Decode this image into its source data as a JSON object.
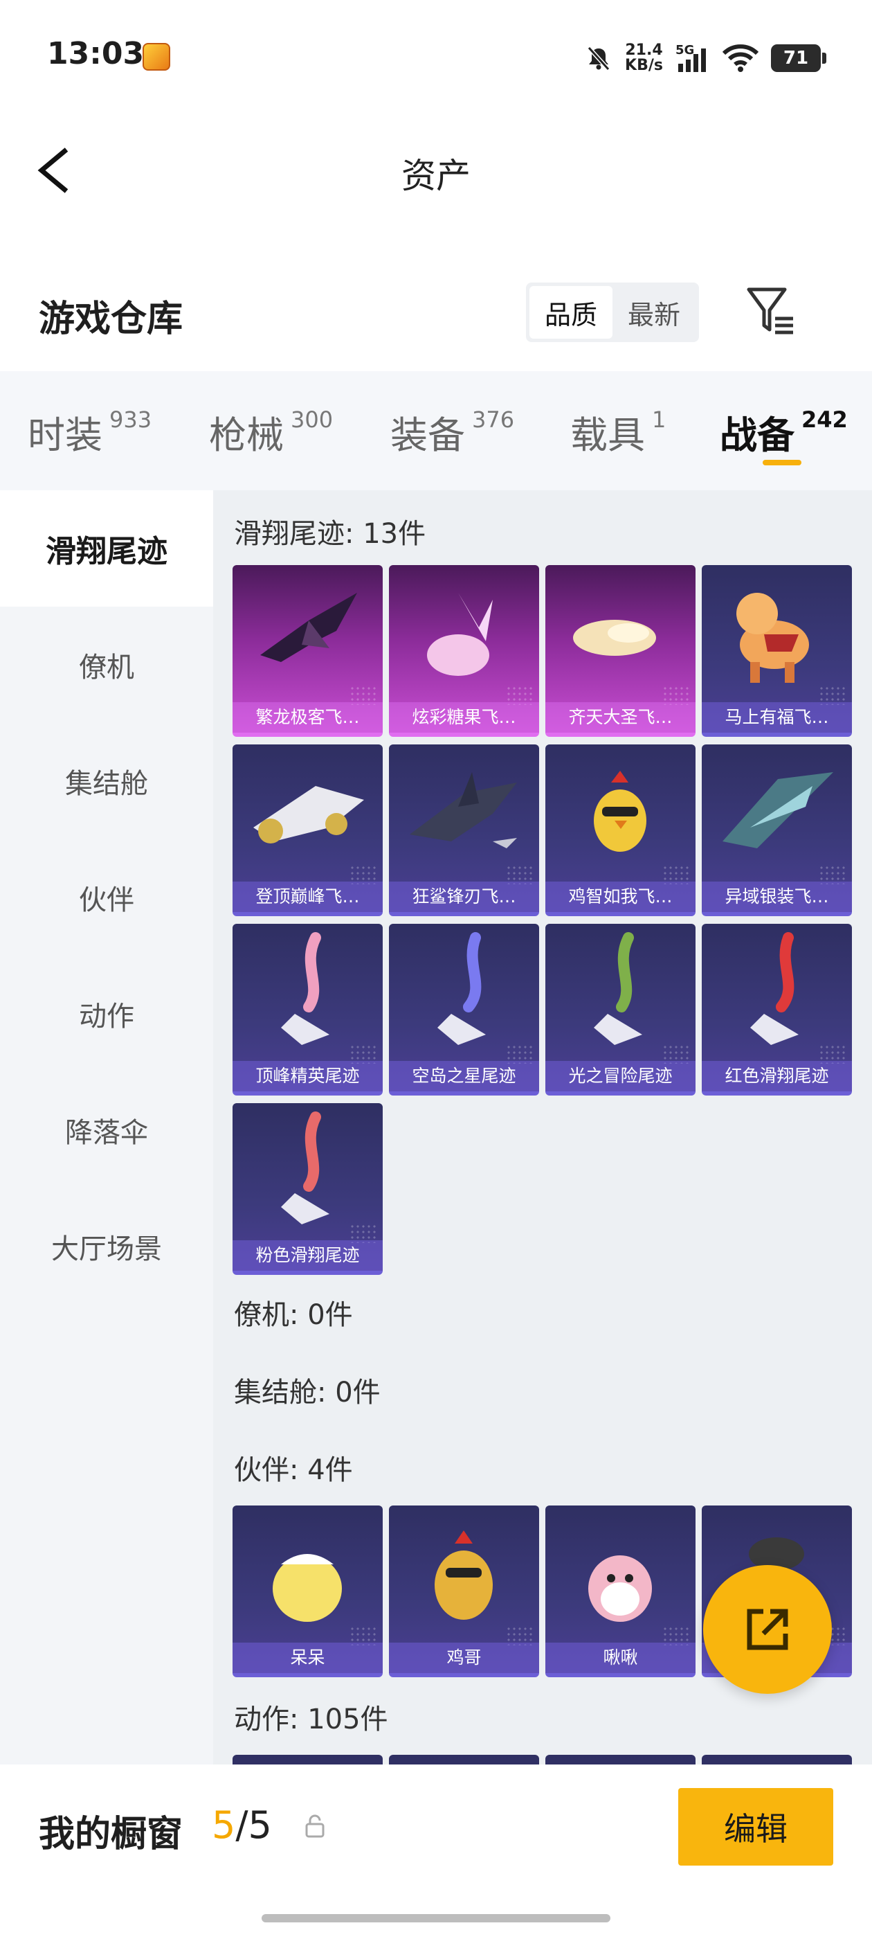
{
  "status_bar": {
    "time": "13:03",
    "net_speed_value": "21.4",
    "net_speed_unit": "KB/s",
    "network": "5G",
    "battery": "71"
  },
  "header": {
    "title": "资产"
  },
  "warehouse": {
    "title": "游戏仓库",
    "sort_options": [
      "品质",
      "最新"
    ],
    "active_sort": "品质"
  },
  "tabs": [
    {
      "label": "时装",
      "count": "933"
    },
    {
      "label": "枪械",
      "count": "300"
    },
    {
      "label": "装备",
      "count": "376"
    },
    {
      "label": "载具",
      "count": "1"
    },
    {
      "label": "战备",
      "count": "242"
    }
  ],
  "active_tab": "战备",
  "sidebar": [
    "滑翔尾迹",
    "僚机",
    "集结舱",
    "伙伴",
    "动作",
    "降落伞",
    "大厅场景"
  ],
  "active_sidebar": "滑翔尾迹",
  "sections": {
    "glide": {
      "header": "滑翔尾迹: 13件",
      "items": [
        "繁龙极客飞…",
        "炫彩糖果飞…",
        "齐天大圣飞…",
        "马上有福飞…",
        "登顶巅峰飞…",
        "狂鲨锋刃飞…",
        "鸡智如我飞…",
        "异域银装飞…",
        "顶峰精英尾迹",
        "空岛之星尾迹",
        "光之冒险尾迹",
        "红色滑翔尾迹",
        "粉色滑翔尾迹"
      ]
    },
    "wingman": {
      "header": "僚机: 0件"
    },
    "capsule": {
      "header": "集结舱: 0件"
    },
    "partner": {
      "header": "伙伴: 4件",
      "items": [
        "呆呆",
        "鸡哥",
        "啾啾",
        ""
      ]
    },
    "emote": {
      "header": "动作: 105件"
    }
  },
  "bottom": {
    "title": "我的橱窗",
    "used": "5",
    "total": "/5",
    "edit_label": "编辑"
  },
  "colors": {
    "accent": "#f9b50d",
    "rare_purple": "#6c5fd6",
    "legend_pink": "#c94ed3"
  }
}
